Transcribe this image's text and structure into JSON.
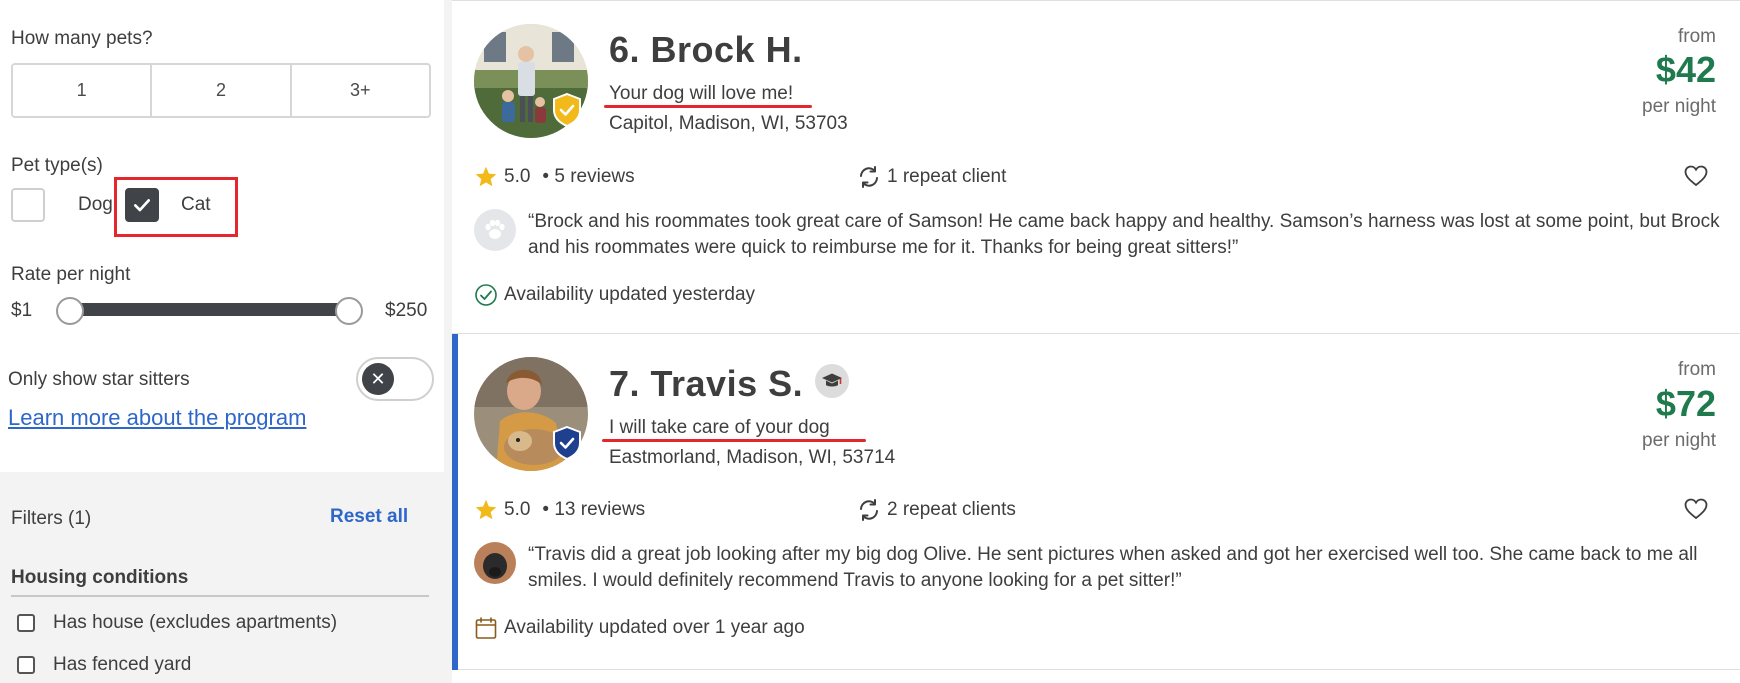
{
  "sidebar": {
    "how_many_pets": {
      "label": "How many pets?",
      "options": [
        "1",
        "2",
        "3+"
      ]
    },
    "pet_types": {
      "label": "Pet type(s)",
      "options": [
        {
          "label": "Dog",
          "checked": false
        },
        {
          "label": "Cat",
          "checked": true
        }
      ]
    },
    "rate": {
      "label": "Rate per night",
      "min_label": "$1",
      "max_label": "$250",
      "range": [
        1,
        250
      ]
    },
    "star_sitters": {
      "label": "Only show star sitters",
      "enabled": false
    },
    "learn_more": "Learn more about the program",
    "filters": {
      "count_label": "Filters (1)",
      "reset_label": "Reset all"
    },
    "housing": {
      "title": "Housing conditions",
      "options": [
        {
          "label": "Has house (excludes apartments)",
          "checked": false
        },
        {
          "label": "Has fenced yard",
          "checked": false
        }
      ]
    }
  },
  "listings": [
    {
      "name": "6. Brock H.",
      "headline": "Your dog will love me!",
      "location": "Capitol, Madison, WI, 53703",
      "from_label": "from",
      "price": "$42",
      "per_night": "per night",
      "rating": "5.0",
      "reviews": "• 5 reviews",
      "repeat_clients": "1 repeat client",
      "review": "“Brock and his roommates took great care of Samson! He came back happy and healthy. Samson’s harness was lost at some point, but Brock and his roommates were quick to reimburse me for it. Thanks for being great sitters!”",
      "availability": "Availability updated yesterday",
      "badge_color": "#f2b91a"
    },
    {
      "name": "7. Travis S.",
      "headline": "I will take care of your dog",
      "location": "Eastmorland, Madison, WI, 53714",
      "from_label": "from",
      "price": "$72",
      "per_night": "per night",
      "rating": "5.0",
      "reviews": "• 13 reviews",
      "repeat_clients": "2 repeat clients",
      "review": "“Travis did a great job looking after my big dog Olive. He sent pictures when asked and got her exercised well too. She came back to me all smiles. I would definitely recommend Travis to anyone looking for a pet sitter!”",
      "availability": "Availability updated over 1 year ago",
      "badge_color": "#1f3f8f"
    }
  ],
  "colors": {
    "accent_blue": "#2e67c9",
    "price_green": "#1f7a4d",
    "star_gold": "#f2b91a",
    "annotation_red": "#e5262c"
  }
}
